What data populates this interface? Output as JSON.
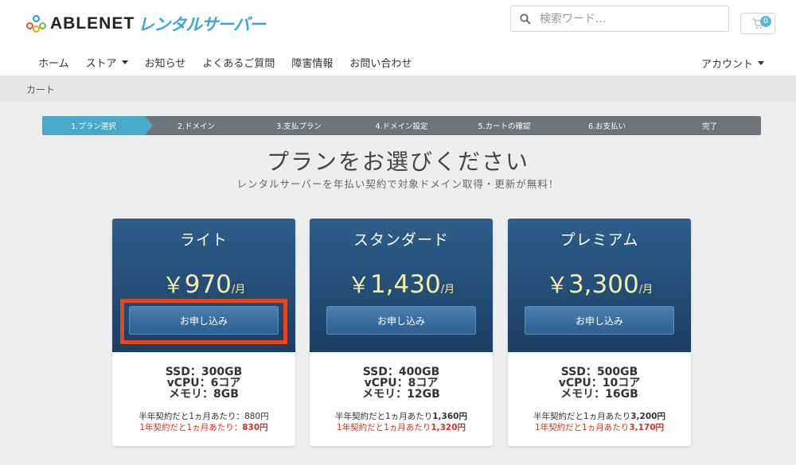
{
  "header": {
    "logo_text": "ABLENET",
    "logo_sub": "レンタルサーバー",
    "search_placeholder": "検索ワード...",
    "cart_count": "0"
  },
  "nav": {
    "items": [
      {
        "label": "ホーム",
        "dropdown": false
      },
      {
        "label": "ストア",
        "dropdown": true
      },
      {
        "label": "お知らせ",
        "dropdown": false
      },
      {
        "label": "よくあるご質問",
        "dropdown": false
      },
      {
        "label": "障害情報",
        "dropdown": false
      },
      {
        "label": "お問い合わせ",
        "dropdown": false
      }
    ],
    "account": "アカウント"
  },
  "breadcrumb": "カート",
  "steps": [
    "1.プラン選択",
    "2.ドメイン",
    "3.支払プラン",
    "4.ドメイン設定",
    "5.カートの確認",
    "6.お支払い",
    "完了"
  ],
  "active_step": 0,
  "page": {
    "title": "プランをお選びください",
    "subtitle": "レンタルサーバーを年払い契約で対象ドメイン取得・更新が無料！"
  },
  "plans": [
    {
      "name": "ライト",
      "currency": "￥",
      "price": "970",
      "per": "/月",
      "apply_label": "お申し込み",
      "specs": [
        "SSD：300GB",
        "vCPU：6コア",
        "メモリ：8GB"
      ],
      "note_half_prefix": "半年契約だと1ヵ月あたり：",
      "note_half_value": "880円",
      "note_year_prefix": "1年契約だと1ヵ月あたり：",
      "note_year_value": "830円",
      "highlighted": true
    },
    {
      "name": "スタンダード",
      "currency": "￥",
      "price": "1,430",
      "per": "/月",
      "apply_label": "お申し込み",
      "specs": [
        "SSD：400GB",
        "vCPU：8コア",
        "メモリ：12GB"
      ],
      "note_half_prefix": "半年契約だと1ヵ月あたり",
      "note_half_value": "1,360円",
      "note_year_prefix": "1年契約だと1ヵ月あたり",
      "note_year_value": "1,320円",
      "highlighted": false
    },
    {
      "name": "プレミアム",
      "currency": "￥",
      "price": "3,300",
      "per": "/月",
      "apply_label": "お申し込み",
      "specs": [
        "SSD：500GB",
        "vCPU：10コア",
        "メモリ：16GB"
      ],
      "note_half_prefix": "半年契約だと1ヵ月あたり",
      "note_half_value": "3,200円",
      "note_year_prefix": "1年契約だと1ヵ月あたり",
      "note_year_value": "3,170円",
      "highlighted": false
    }
  ],
  "colors": {
    "brand_blue": "#3ea6d8",
    "plan_header": "#1b3e63",
    "price_text": "#f4efa8",
    "step_active": "#48a9c9",
    "highlight_red": "#e2471f",
    "note_red": "#d0341f"
  }
}
